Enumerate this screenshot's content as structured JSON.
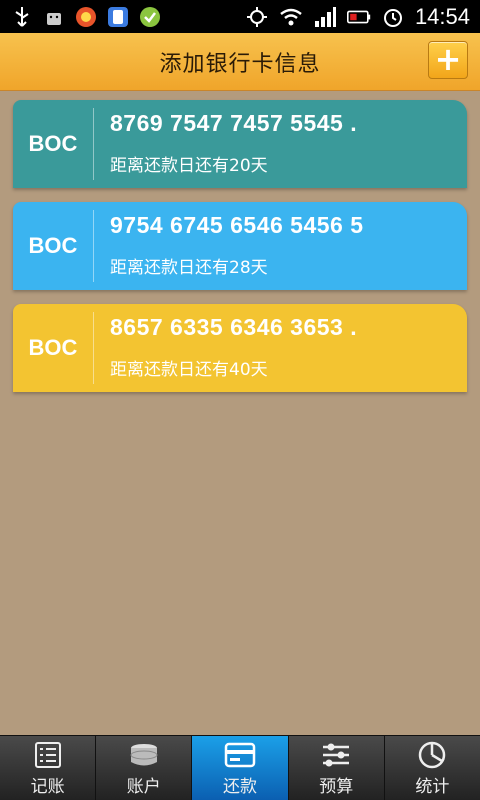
{
  "status_bar": {
    "time": "14:54",
    "icons": [
      "usb-icon",
      "android-debug-icon",
      "app-notification-icon",
      "sync-icon",
      "check-icon",
      "gps-icon",
      "wifi-icon",
      "signal-icon",
      "battery-icon",
      "alarm-icon"
    ]
  },
  "header": {
    "title": "添加银行卡信息",
    "add_label": "+"
  },
  "cards": [
    {
      "bank": "BOC",
      "number": "8769 7547 7457 5545 .",
      "due": "距离还款日还有20天",
      "color": "#3a9a9a"
    },
    {
      "bank": "BOC",
      "number": "9754 6745 6546 5456 5",
      "due": "距离还款日还有28天",
      "color": "#3bb4f0"
    },
    {
      "bank": "BOC",
      "number": "8657 6335 6346 3653 .",
      "due": "距离还款日还有40天",
      "color": "#f3c431"
    }
  ],
  "tabs": [
    {
      "label": "记账",
      "icon": "ledger-icon",
      "active": false
    },
    {
      "label": "账户",
      "icon": "coins-icon",
      "active": false
    },
    {
      "label": "还款",
      "icon": "card-icon",
      "active": true
    },
    {
      "label": "预算",
      "icon": "sliders-icon",
      "active": false
    },
    {
      "label": "统计",
      "icon": "pie-chart-icon",
      "active": false
    }
  ]
}
